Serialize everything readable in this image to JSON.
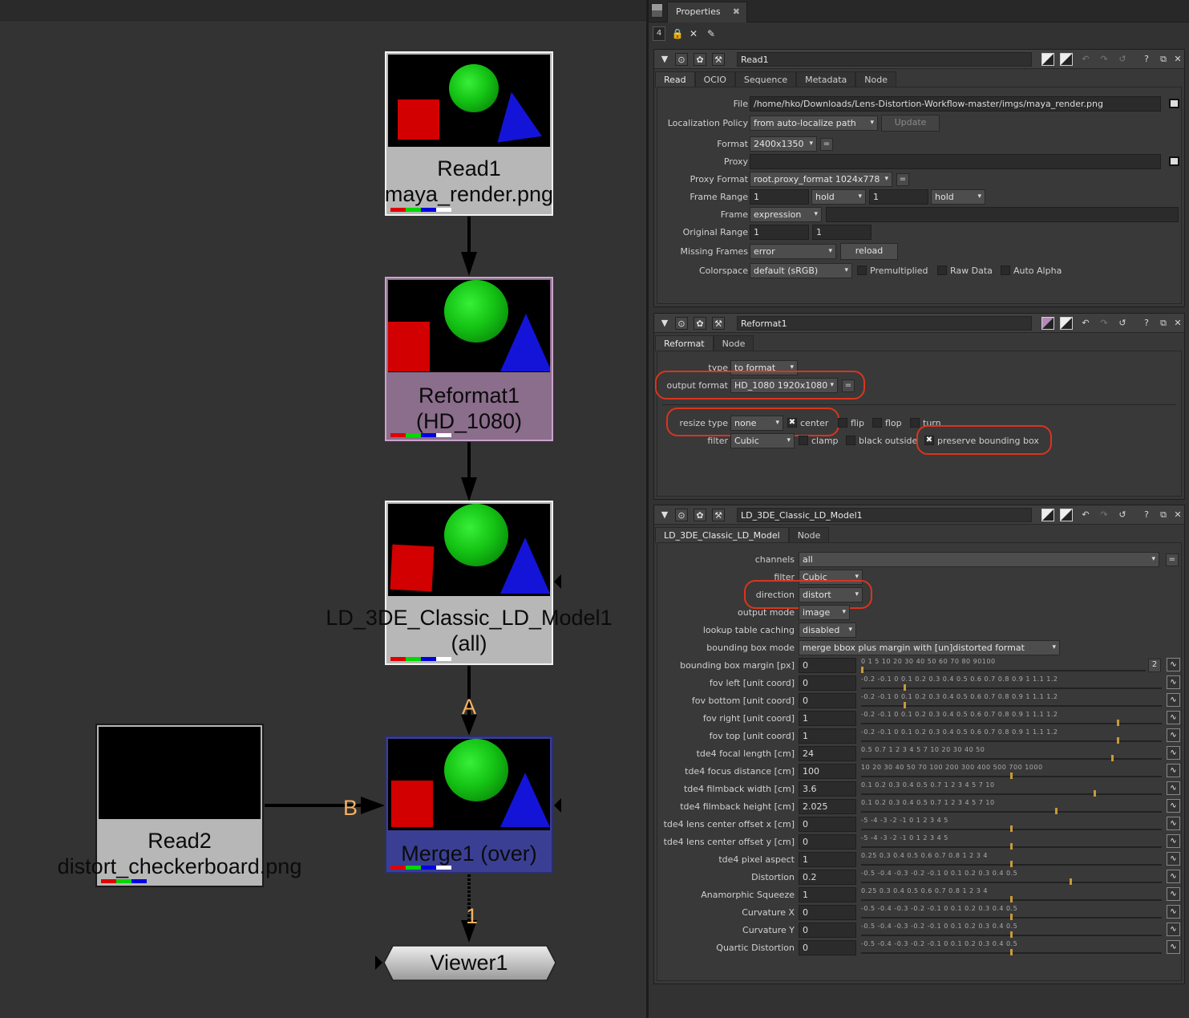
{
  "colors": {
    "red": "#e00000",
    "green": "#00d800",
    "blue": "#0000e0",
    "white": "#ffffff",
    "highlight": "#d9351d",
    "edge_label": "#f5b062"
  },
  "graph": {
    "read1": {
      "title": "Read1",
      "subtitle": "maya_render.png",
      "color": "#b7b7b7"
    },
    "reformat1": {
      "title": "Reformat1",
      "subtitle": "(HD_1080)",
      "color": "#8b6d8c"
    },
    "ld_model": {
      "title": "LD_3DE_Classic_LD_Model1",
      "subtitle": "(all)",
      "color": "#b7b7b7"
    },
    "read2": {
      "title": "Read2",
      "subtitle": "distort_checkerboard.png",
      "color": "#b7b7b7"
    },
    "merge1": {
      "title": "Merge1 (over)",
      "color": "#3b3f93"
    },
    "viewer1": {
      "title": "Viewer1"
    },
    "edges": {
      "a": "A",
      "b": "B",
      "one": "1"
    }
  },
  "properties": {
    "tab_label": "Properties",
    "tab_close": "✖",
    "node_count": "4",
    "read_panel": {
      "name": "Read1",
      "tabs": [
        "Read",
        "OCIO",
        "Sequence",
        "Metadata",
        "Node"
      ],
      "file_label": "File",
      "file_value": "/home/hko/Downloads/Lens-Distortion-Workflow-master/imgs/maya_render.png",
      "localization_label": "Localization Policy",
      "localization_value": "from auto-localize path",
      "update_label": "Update",
      "format_label": "Format",
      "format_value": "2400x1350",
      "proxy_label": "Proxy",
      "proxy_format_label": "Proxy Format",
      "proxy_format_value": "root.proxy_format 1024x778",
      "frame_range_label": "Frame Range",
      "frame_range_start": "1",
      "frame_range_before": "hold",
      "frame_range_end": "1",
      "frame_range_after": "hold",
      "frame_label": "Frame",
      "frame_mode": "expression",
      "original_range_label": "Original Range",
      "original_range_start": "1",
      "original_range_end": "1",
      "missing_frames_label": "Missing Frames",
      "missing_frames_value": "error",
      "reload_label": "reload",
      "colorspace_label": "Colorspace",
      "colorspace_value": "default (sRGB)",
      "premultiplied_label": "Premultiplied",
      "raw_data_label": "Raw Data",
      "auto_alpha_label": "Auto Alpha"
    },
    "reformat_panel": {
      "name": "Reformat1",
      "tabs": [
        "Reformat",
        "Node"
      ],
      "type_label": "type",
      "type_value": "to format",
      "output_format_label": "output format",
      "output_format_value": "HD_1080 1920x1080",
      "resize_type_label": "resize type",
      "resize_type_value": "none",
      "center_label": "center",
      "flip_label": "flip",
      "flop_label": "flop",
      "turn_label": "turn",
      "filter_label": "filter",
      "filter_value": "Cubic",
      "clamp_label": "clamp",
      "black_outside_label": "black outside",
      "preserve_bbox_label": "preserve bounding box"
    },
    "ld_panel": {
      "name": "LD_3DE_Classic_LD_Model1",
      "tabs": [
        "LD_3DE_Classic_LD_Model",
        "Node"
      ],
      "channels_label": "channels",
      "channels_value": "all",
      "filter_label": "filter",
      "filter_value": "Cubic",
      "direction_label": "direction",
      "direction_value": "distort",
      "output_mode_label": "output mode",
      "output_mode_value": "image",
      "lookup_label": "lookup table caching",
      "lookup_value": "disabled",
      "bbox_mode_label": "bounding box mode",
      "bbox_mode_value": "merge bbox plus margin with [un]distorted format",
      "two_label": "2",
      "knobs": [
        {
          "label": "bounding box margin [px]",
          "value": "0",
          "ticks": "0     1          5          10            20         30      40    50    60    70    80  90100",
          "pos": 0.0
        },
        {
          "label": "fov left [unit coord]",
          "value": "0",
          "ticks": "-0.2   -0.1    0        0.1      0.2      0.3      0.4      0.5      0.6      0.7      0.8      0.9       1     1.1 1.2",
          "pos": 0.143
        },
        {
          "label": "fov bottom [unit coord]",
          "value": "0",
          "ticks": "-0.2   -0.1    0        0.1      0.2      0.3      0.4      0.5      0.6      0.7      0.8      0.9       1     1.1 1.2",
          "pos": 0.143
        },
        {
          "label": "fov right [unit coord]",
          "value": "1",
          "ticks": "-0.2   -0.1    0        0.1      0.2      0.3      0.4      0.5      0.6      0.7      0.8      0.9       1     1.1 1.2",
          "pos": 0.857
        },
        {
          "label": "fov top [unit coord]",
          "value": "1",
          "ticks": "-0.2   -0.1    0        0.1      0.2      0.3      0.4      0.5      0.6      0.7      0.8      0.9       1     1.1 1.2",
          "pos": 0.857
        },
        {
          "label": "tde4 focal length [cm]",
          "value": "24",
          "ticks": "0.5    0.7     1                   2          3       4      5          7          10                              20        30    40 50",
          "pos": 0.84
        },
        {
          "label": "tde4 focus distance [cm]",
          "value": "100",
          "ticks": "10                  20        30     40   50        70          100                      200       300    400 500   700 1000",
          "pos": 0.5
        },
        {
          "label": "tde4 filmback width [cm]",
          "value": "3.6",
          "ticks": "0.1                 0.2       0.3   0.4  0.5    0.7     1                       2           3       4       5         7       10",
          "pos": 0.78
        },
        {
          "label": "tde4 filmback height [cm]",
          "value": "2.025",
          "ticks": "0.1                 0.2       0.3   0.4  0.5    0.7     1                       2           3       4       5         7       10",
          "pos": 0.65
        },
        {
          "label": "tde4 lens center offset x [cm]",
          "value": "0",
          "ticks": "-5            -4            -3            -2            -1            0            1            2            3            4            5",
          "pos": 0.5
        },
        {
          "label": "tde4 lens center offset y [cm]",
          "value": "0",
          "ticks": "-5            -4            -3            -2            -1            0            1            2            3            4            5",
          "pos": 0.5
        },
        {
          "label": "tde4 pixel aspect",
          "value": "1",
          "ticks": "0.25  0.3           0.4       0.5      0.6    0.7  0.8      1                               2                       3                4",
          "pos": 0.5
        },
        {
          "label": "Distortion",
          "value": "0.2",
          "ticks": "-0.5         -0.4          -0.3          -0.2          -0.1           0            0.1           0.2           0.3           0.4     0.5",
          "pos": 0.7
        },
        {
          "label": "Anamorphic Squeeze",
          "value": "1",
          "ticks": "0.25  0.3           0.4       0.5      0.6    0.7  0.8      1                               2                       3                4",
          "pos": 0.5
        },
        {
          "label": "Curvature X",
          "value": "0",
          "ticks": "-0.5         -0.4          -0.3          -0.2          -0.1           0            0.1           0.2           0.3           0.4     0.5",
          "pos": 0.5
        },
        {
          "label": "Curvature Y",
          "value": "0",
          "ticks": "-0.5         -0.4          -0.3          -0.2          -0.1           0            0.1           0.2           0.3           0.4     0.5",
          "pos": 0.5
        },
        {
          "label": "Quartic Distortion",
          "value": "0",
          "ticks": "-0.5         -0.4          -0.3          -0.2          -0.1           0            0.1           0.2           0.3           0.4     0.5",
          "pos": 0.5
        }
      ]
    }
  }
}
